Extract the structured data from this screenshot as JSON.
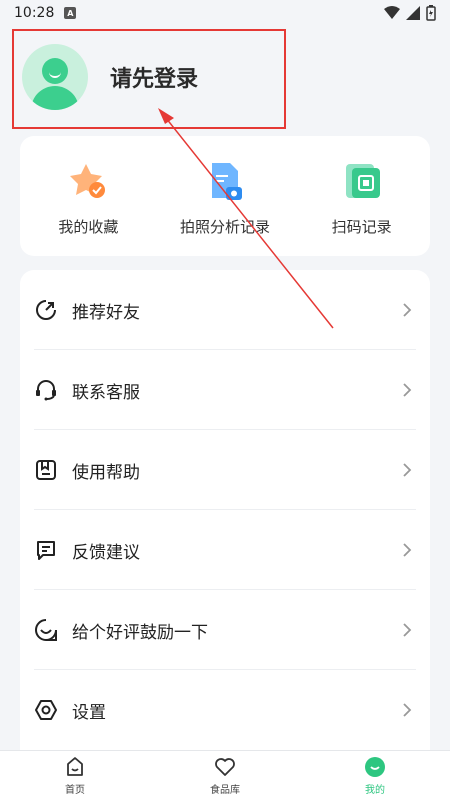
{
  "status_bar": {
    "time": "10:28",
    "notification_badge": "A"
  },
  "login": {
    "prompt": "请先登录"
  },
  "quick_actions": [
    {
      "label": "我的收藏",
      "icon": "star-favorite-icon"
    },
    {
      "label": "拍照分析记录",
      "icon": "photo-document-icon"
    },
    {
      "label": "扫码记录",
      "icon": "scan-record-icon"
    }
  ],
  "menu": [
    {
      "label": "推荐好友",
      "icon": "share-refresh-icon"
    },
    {
      "label": "联系客服",
      "icon": "headset-icon"
    },
    {
      "label": "使用帮助",
      "icon": "help-book-icon"
    },
    {
      "label": "反馈建议",
      "icon": "feedback-message-icon"
    },
    {
      "label": "给个好评鼓励一下",
      "icon": "smile-icon"
    },
    {
      "label": "设置",
      "icon": "settings-hexagon-icon"
    }
  ],
  "bottom_nav": [
    {
      "label": "首页",
      "icon": "home-icon"
    },
    {
      "label": "食品库",
      "icon": "heart-icon"
    },
    {
      "label": "我的",
      "icon": "profile-smile-icon",
      "active": true
    }
  ],
  "colors": {
    "accent": "#2dc680",
    "annotation": "#e53935"
  }
}
